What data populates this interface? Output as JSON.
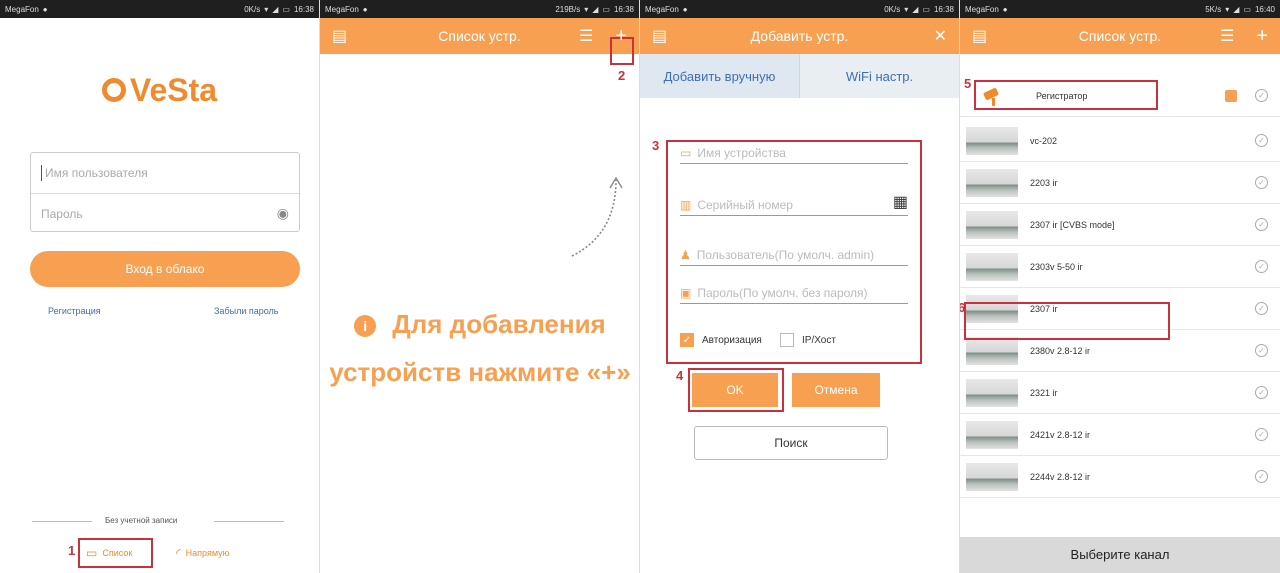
{
  "status": {
    "s1": {
      "carrier": "MegaFon",
      "info": "0K/s",
      "time": "16:38"
    },
    "s2": {
      "carrier": "MegaFon",
      "info": "219B/s",
      "time": "16:38"
    },
    "s3": {
      "carrier": "MegaFon",
      "info": "0K/s",
      "time": "16:38"
    },
    "s4": {
      "carrier": "MegaFon",
      "info": "5K/s",
      "time": "16:40"
    }
  },
  "colors": {
    "accent": "#f7a052",
    "annotation": "#c8323c",
    "link": "#3d6fb3"
  },
  "login": {
    "logo": "VeSta",
    "username_placeholder": "Имя пользователя",
    "password_placeholder": "Пароль",
    "login_button": "Вход в облако",
    "register_link": "Регистрация",
    "forgot_link": "Забыли пароль",
    "no_account": "Без учетной записи",
    "tab_list": "Список",
    "tab_direct": "Напрямую",
    "marker": "1"
  },
  "device_list_empty": {
    "title": "Список устр.",
    "hint_line1": "Для добавления",
    "hint_line2": "устройств нажмите «+»",
    "marker": "2"
  },
  "add_device": {
    "title": "Добавить устр.",
    "tab_manual": "Добавить вручную",
    "tab_wifi": "WiFi настр.",
    "device_name_placeholder": "Имя устройства",
    "serial_placeholder": "Серийный номер",
    "user_placeholder": "Пользователь(По умолч. admin)",
    "password_placeholder": "Пароль(По умолч. без пароля)",
    "auth_label": "Авторизация",
    "ip_label": "IP/Хост",
    "ok_button": "OK",
    "cancel_button": "Отмена",
    "search_button": "Поиск",
    "marker_form": "3",
    "marker_ok": "4"
  },
  "device_list": {
    "title": "Список устр.",
    "devices": [
      {
        "name": "Регистратор"
      },
      {
        "name": "vc-202"
      },
      {
        "name": "2203 ir"
      },
      {
        "name": "2307 ir [CVBS mode]"
      },
      {
        "name": "2303v 5-50 ir"
      },
      {
        "name": "2307 ir"
      },
      {
        "name": "2380v 2.8-12 ir"
      },
      {
        "name": "2321 ir"
      },
      {
        "name": "2421v 2.8-12 ir"
      },
      {
        "name": "2244v 2.8-12 ir"
      }
    ],
    "footer": "Выберите канал",
    "marker_recorder": "5",
    "marker_camera": "6"
  }
}
